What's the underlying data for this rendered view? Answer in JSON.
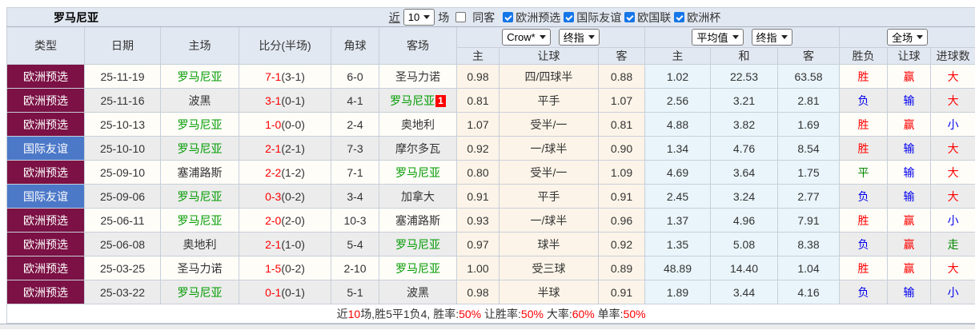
{
  "title": "罗马尼亚",
  "colors": {
    "type_qualifier": "#7B1144",
    "type_friendly": "#4C78C8",
    "team_green": "#009B00",
    "red": "#FF0000",
    "blue": "#0000EE",
    "green": "#008800",
    "crow_bg": "#FCF4E8",
    "avg_bg": "#E9F5FB",
    "header_bg": "#E2E8F1"
  },
  "filters": {
    "recent_label": "近",
    "recent_count": "10",
    "matches_label": "场",
    "same_away": {
      "label": "同客",
      "checked": false
    },
    "competitions": [
      {
        "label": "欧洲预选",
        "checked": true
      },
      {
        "label": "国际友谊",
        "checked": true
      },
      {
        "label": "欧国联",
        "checked": true
      },
      {
        "label": "欧洲杯",
        "checked": true
      }
    ]
  },
  "dropdowns": {
    "odds_source": "Crow*",
    "odds_time": "终指",
    "avg_source": "平均值",
    "avg_time": "终指",
    "scope": "全场"
  },
  "table": {
    "columns": [
      "类型",
      "日期",
      "主场",
      "比分(半场)",
      "角球",
      "客场"
    ],
    "sub_columns": [
      "主",
      "让球",
      "客",
      "主",
      "和",
      "客",
      "胜负",
      "让球",
      "进球数"
    ],
    "rows": [
      {
        "type": "欧洲预选",
        "type_color": "maroon",
        "date": "25-11-19",
        "home": "罗马尼亚",
        "home_green": true,
        "score": "7-1",
        "half": "(3-1)",
        "corner": "6-0",
        "away": "圣马力诺",
        "away_green": false,
        "away_badge": "",
        "handicap_home": "0.98",
        "handicap": "四/四球半",
        "handicap_away": "0.88",
        "avg_home": "1.02",
        "avg_draw": "22.53",
        "avg_away": "63.58",
        "result": "胜",
        "result_color": "red",
        "handicap_result": "赢",
        "handicap_result_color": "red",
        "goals": "大",
        "goals_color": "red"
      },
      {
        "type": "欧洲预选",
        "type_color": "maroon",
        "date": "25-11-16",
        "home": "波黑",
        "home_green": false,
        "score": "3-1",
        "half": "(0-1)",
        "corner": "4-1",
        "away": "罗马尼亚",
        "away_green": true,
        "away_badge": "1",
        "handicap_home": "0.81",
        "handicap": "平手",
        "handicap_away": "1.07",
        "avg_home": "2.56",
        "avg_draw": "3.21",
        "avg_away": "2.81",
        "result": "负",
        "result_color": "blue",
        "handicap_result": "输",
        "handicap_result_color": "blue",
        "goals": "大",
        "goals_color": "red"
      },
      {
        "type": "欧洲预选",
        "type_color": "maroon",
        "date": "25-10-13",
        "home": "罗马尼亚",
        "home_green": true,
        "score": "1-0",
        "half": "(0-0)",
        "corner": "2-4",
        "away": "奥地利",
        "away_green": false,
        "away_badge": "",
        "handicap_home": "1.07",
        "handicap": "受半/一",
        "handicap_away": "0.81",
        "avg_home": "4.88",
        "avg_draw": "3.82",
        "avg_away": "1.69",
        "result": "胜",
        "result_color": "red",
        "handicap_result": "赢",
        "handicap_result_color": "red",
        "goals": "小",
        "goals_color": "blue"
      },
      {
        "type": "国际友谊",
        "type_color": "blue",
        "date": "25-10-10",
        "home": "罗马尼亚",
        "home_green": true,
        "score": "2-1",
        "half": "(2-1)",
        "corner": "7-3",
        "away": "摩尔多瓦",
        "away_green": false,
        "away_badge": "",
        "handicap_home": "0.92",
        "handicap": "一/球半",
        "handicap_away": "0.90",
        "avg_home": "1.34",
        "avg_draw": "4.76",
        "avg_away": "8.54",
        "result": "胜",
        "result_color": "red",
        "handicap_result": "输",
        "handicap_result_color": "blue",
        "goals": "大",
        "goals_color": "red"
      },
      {
        "type": "欧洲预选",
        "type_color": "maroon",
        "date": "25-09-10",
        "home": "塞浦路斯",
        "home_green": false,
        "score": "2-2",
        "half": "(1-2)",
        "corner": "7-1",
        "away": "罗马尼亚",
        "away_green": true,
        "away_badge": "",
        "handicap_home": "0.80",
        "handicap": "受半/一",
        "handicap_away": "1.09",
        "avg_home": "4.69",
        "avg_draw": "3.64",
        "avg_away": "1.75",
        "result": "平",
        "result_color": "green",
        "handicap_result": "输",
        "handicap_result_color": "blue",
        "goals": "大",
        "goals_color": "red"
      },
      {
        "type": "国际友谊",
        "type_color": "blue",
        "date": "25-09-06",
        "home": "罗马尼亚",
        "home_green": true,
        "score": "0-3",
        "half": "(0-2)",
        "corner": "3-4",
        "away": "加拿大",
        "away_green": false,
        "away_badge": "",
        "handicap_home": "0.91",
        "handicap": "平手",
        "handicap_away": "0.91",
        "avg_home": "2.45",
        "avg_draw": "3.24",
        "avg_away": "2.77",
        "result": "负",
        "result_color": "blue",
        "handicap_result": "输",
        "handicap_result_color": "blue",
        "goals": "大",
        "goals_color": "red"
      },
      {
        "type": "欧洲预选",
        "type_color": "maroon",
        "date": "25-06-11",
        "home": "罗马尼亚",
        "home_green": true,
        "score": "2-0",
        "half": "(2-0)",
        "corner": "10-3",
        "away": "塞浦路斯",
        "away_green": false,
        "away_badge": "",
        "handicap_home": "0.93",
        "handicap": "一/球半",
        "handicap_away": "0.96",
        "avg_home": "1.37",
        "avg_draw": "4.96",
        "avg_away": "7.91",
        "result": "胜",
        "result_color": "red",
        "handicap_result": "赢",
        "handicap_result_color": "red",
        "goals": "小",
        "goals_color": "blue"
      },
      {
        "type": "欧洲预选",
        "type_color": "maroon",
        "date": "25-06-08",
        "home": "奥地利",
        "home_green": false,
        "score": "2-1",
        "half": "(1-0)",
        "corner": "5-4",
        "away": "罗马尼亚",
        "away_green": true,
        "away_badge": "",
        "handicap_home": "0.97",
        "handicap": "球半",
        "handicap_away": "0.92",
        "avg_home": "1.35",
        "avg_draw": "5.08",
        "avg_away": "8.38",
        "result": "负",
        "result_color": "blue",
        "handicap_result": "赢",
        "handicap_result_color": "red",
        "goals": "走",
        "goals_color": "green"
      },
      {
        "type": "欧洲预选",
        "type_color": "maroon",
        "date": "25-03-25",
        "home": "圣马力诺",
        "home_green": false,
        "score": "1-5",
        "half": "(0-2)",
        "corner": "2-10",
        "away": "罗马尼亚",
        "away_green": true,
        "away_badge": "",
        "handicap_home": "1.00",
        "handicap": "受三球",
        "handicap_away": "0.89",
        "avg_home": "48.89",
        "avg_draw": "14.40",
        "avg_away": "1.04",
        "result": "胜",
        "result_color": "red",
        "handicap_result": "赢",
        "handicap_result_color": "red",
        "goals": "大",
        "goals_color": "red"
      },
      {
        "type": "欧洲预选",
        "type_color": "maroon",
        "date": "25-03-22",
        "home": "罗马尼亚",
        "home_green": true,
        "score": "0-1",
        "half": "(0-1)",
        "corner": "5-1",
        "away": "波黑",
        "away_green": false,
        "away_badge": "",
        "handicap_home": "0.98",
        "handicap": "半球",
        "handicap_away": "0.91",
        "avg_home": "1.89",
        "avg_draw": "3.44",
        "avg_away": "4.16",
        "result": "负",
        "result_color": "blue",
        "handicap_result": "输",
        "handicap_result_color": "blue",
        "goals": "小",
        "goals_color": "blue"
      }
    ]
  },
  "footer": {
    "segments": [
      {
        "text": "近",
        "color": "black"
      },
      {
        "text": "10",
        "color": "red"
      },
      {
        "text": "场,胜5平1负4, 胜率:",
        "color": "black"
      },
      {
        "text": "50%",
        "color": "red"
      },
      {
        "text": " 让胜率:",
        "color": "black"
      },
      {
        "text": "50%",
        "color": "red"
      },
      {
        "text": " 大率:",
        "color": "black"
      },
      {
        "text": "60%",
        "color": "red"
      },
      {
        "text": " 单率:",
        "color": "black"
      },
      {
        "text": "50%",
        "color": "red"
      }
    ]
  }
}
